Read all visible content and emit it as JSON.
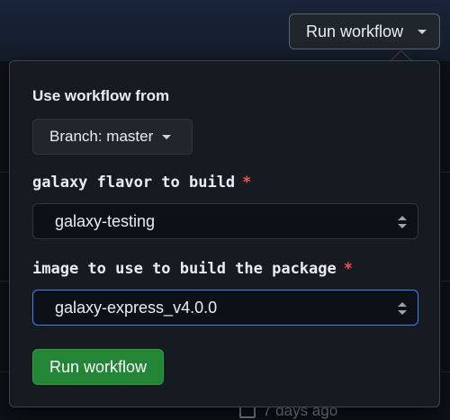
{
  "header": {
    "run_workflow_label": "Run workflow"
  },
  "background": {
    "date_text": "7 days ago"
  },
  "popup": {
    "use_workflow_from": "Use workflow from",
    "branch_label": "Branch: master",
    "fields": [
      {
        "label": "galaxy flavor to build",
        "required_mark": "*",
        "value": "galaxy-testing"
      },
      {
        "label": "image to use to build the package",
        "required_mark": "*",
        "value": "galaxy-express_v4.0.0"
      }
    ],
    "submit_label": "Run workflow"
  },
  "colors": {
    "accent_green": "#238636",
    "required_red": "#f85149",
    "focus_blue": "#3b82f6"
  }
}
